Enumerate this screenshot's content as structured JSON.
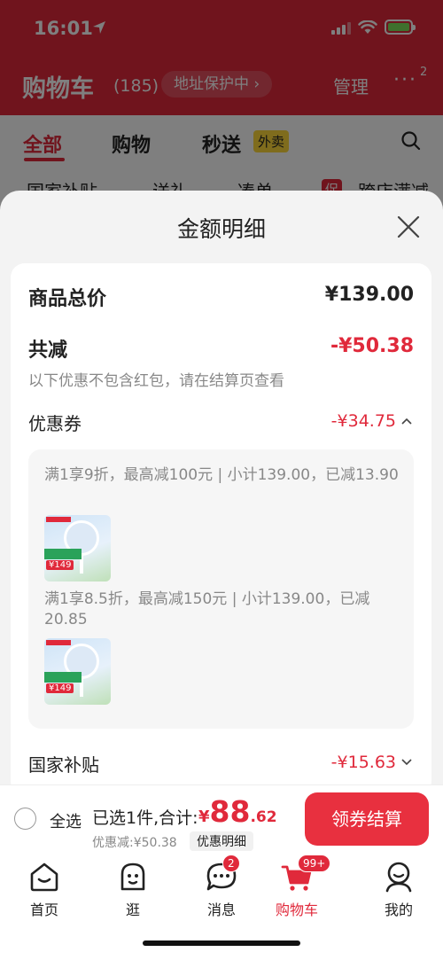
{
  "status_bar": {
    "time": "16:01"
  },
  "background": {
    "title": "购物车",
    "count": "(185)",
    "address_protection": "地址保护中 ›",
    "manage": "管理",
    "more": "···",
    "more_badge": "2",
    "tabs": [
      {
        "label": "全部",
        "active": true
      },
      {
        "label": "购物",
        "active": false
      },
      {
        "label": "秒送",
        "active": false
      }
    ],
    "tab_tag": "外卖",
    "chips": [
      "国家补贴",
      "送礼",
      "凑单",
      "跨店满减"
    ],
    "chip_tag": "促"
  },
  "sheet": {
    "title": "金额明细",
    "total_price_label": "商品总价",
    "total_price_value": "¥139.00",
    "reduction_label": "共减",
    "reduction_value": "-¥50.38",
    "reduction_note": "以下优惠不包含红包，请在结算页查看",
    "coupon_label": "优惠券",
    "coupon_value": "-¥34.75",
    "coupons": [
      {
        "text": "满1享9折，最高减100元 | 小计139.00，已减13.90",
        "thumb_price": "¥149"
      },
      {
        "text": "满1享8.5折，最高减150元 | 小计139.00，已减20.85",
        "thumb_price": "¥149"
      }
    ],
    "subsidy_label": "国家补贴",
    "subsidy_value": "-¥15.63"
  },
  "checkout": {
    "select_all": "全选",
    "selected_info": "已选1件,合计:",
    "currency": "¥",
    "total_integer": "88",
    "total_decimal": ".62",
    "discount_info": "优惠减:¥50.38",
    "detail_button": "优惠明细",
    "checkout_button": "领券结算"
  },
  "tabbar": {
    "items": [
      {
        "label": "首页",
        "icon": "home-icon"
      },
      {
        "label": "逛",
        "icon": "browse-icon"
      },
      {
        "label": "消息",
        "icon": "message-icon",
        "badge": "2"
      },
      {
        "label": "购物车",
        "icon": "cart-icon",
        "badge": "99+",
        "active": true
      },
      {
        "label": "我的",
        "icon": "profile-icon"
      }
    ]
  },
  "colors": {
    "accent": "#e0293b",
    "checkout_button": "#e8303f",
    "thumb_band": "#2aa25a"
  }
}
